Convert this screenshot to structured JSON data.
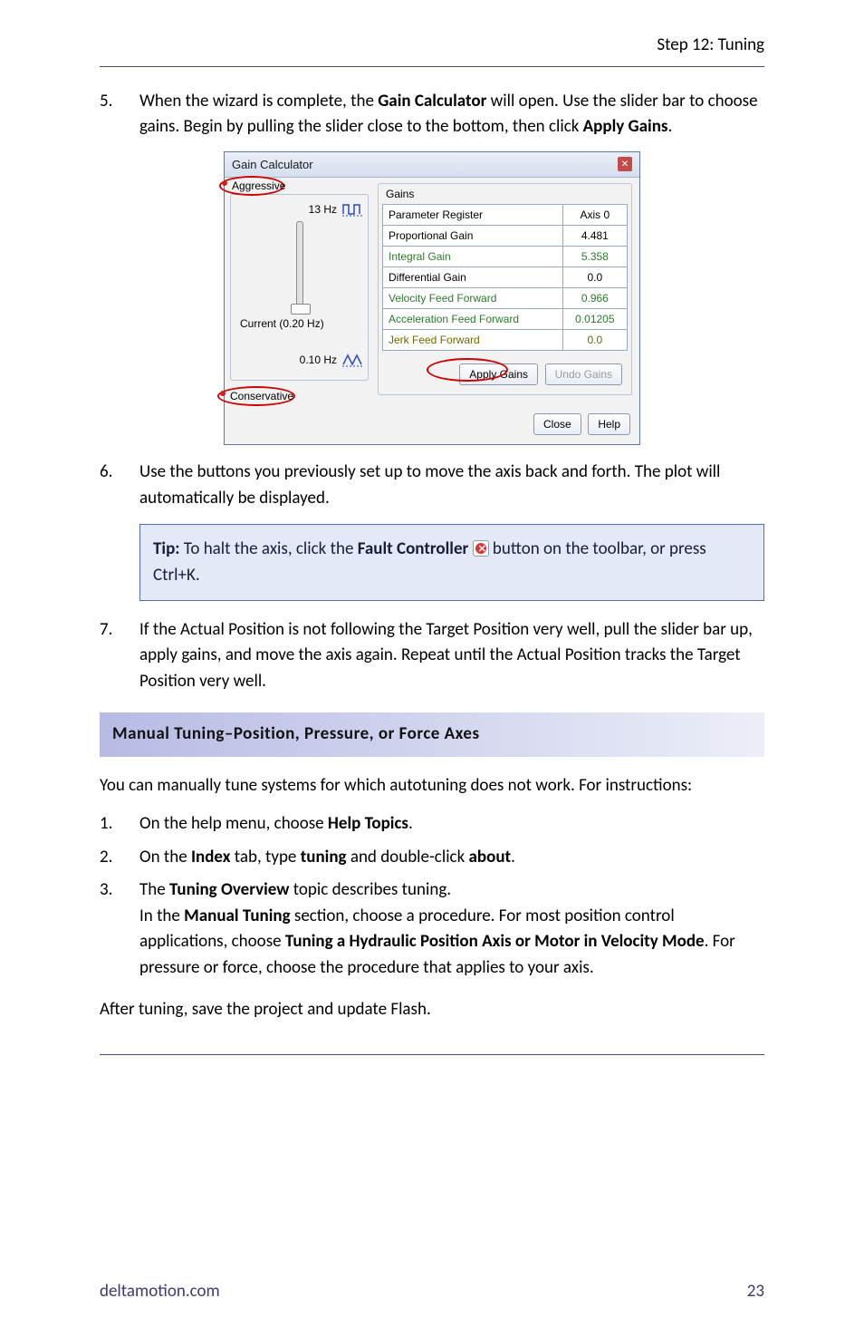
{
  "header": {
    "title": "Step 12: Tuning"
  },
  "step5": {
    "num": "5.",
    "t1": "When the wizard is complete, the ",
    "b1": "Gain Calculator",
    "t2": " will open. Use the slider bar to choose gains. Begin by pulling the slider close to the bottom, then click ",
    "b2": "Apply Gains",
    "t3": "."
  },
  "dialog": {
    "title": "Gain Calculator",
    "aggressive": "Aggressive",
    "conservative": "Conservative",
    "topHz": "13 Hz",
    "current": "Current (",
    "currentHz": "0.20 Hz)",
    "lowHz": "0.10 Hz",
    "gainsLabel": "Gains",
    "headerParam": "Parameter Register",
    "headerAxis": "Axis 0",
    "rows": [
      {
        "name": "Proportional Gain",
        "val": "4.481",
        "cls": ""
      },
      {
        "name": "Integral Gain",
        "val": "5.358",
        "cls": "green"
      },
      {
        "name": "Differential Gain",
        "val": "0.0",
        "cls": ""
      },
      {
        "name": "Velocity Feed Forward",
        "val": "0.966",
        "cls": "green"
      },
      {
        "name": "Acceleration Feed Forward",
        "val": "0.01205",
        "cls": "green"
      },
      {
        "name": "Jerk Feed Forward",
        "val": "0.0",
        "cls": "olive"
      }
    ],
    "applyGains": "Apply Gains",
    "undoGains": "Undo Gains",
    "close": "Close",
    "help": "Help"
  },
  "step6": {
    "num": "6.",
    "text": "Use the buttons you previously set up to move the axis back and forth. The plot will automatically be displayed."
  },
  "tip": {
    "label": "Tip:",
    "t1": " To halt the axis, click the ",
    "b1": "Fault Controller",
    "t2": "  button on the toolbar, or press Ctrl+K."
  },
  "step7": {
    "num": "7.",
    "text": "If the Actual Position is not following the Target Position very well, pull the slider bar up, apply gains, and move the axis again. Repeat until the Actual Position tracks the Target Position very well."
  },
  "section": {
    "title": "Manual Tuning–Position, Pressure, or Force Axes"
  },
  "intro": "You can manually tune systems for which autotuning does not work. For instructions:",
  "m1": {
    "num": "1.",
    "t1": "On the help menu, choose ",
    "b1": "Help Topics",
    "t2": "."
  },
  "m2": {
    "num": "2.",
    "t1": "On the ",
    "b1": "Index",
    "t2": " tab, type ",
    "b2": "tuning",
    "t3": " and double-click ",
    "b3": "about",
    "t4": "."
  },
  "m3": {
    "num": "3.",
    "t1": "The ",
    "b1": "Tuning Overview",
    "t2": " topic describes tuning.",
    "t3": "In the ",
    "b2": "Manual Tuning",
    "t4": " section, choose a procedure. For most position control applications, choose ",
    "b3": "Tuning a Hydraulic Position Axis or Motor in Velocity Mode",
    "t5": ". For pressure or force, choose the procedure that applies to your axis."
  },
  "closing": "After tuning, save the project and update Flash.",
  "footer": {
    "site": "deltamotion.com",
    "page": "23"
  }
}
